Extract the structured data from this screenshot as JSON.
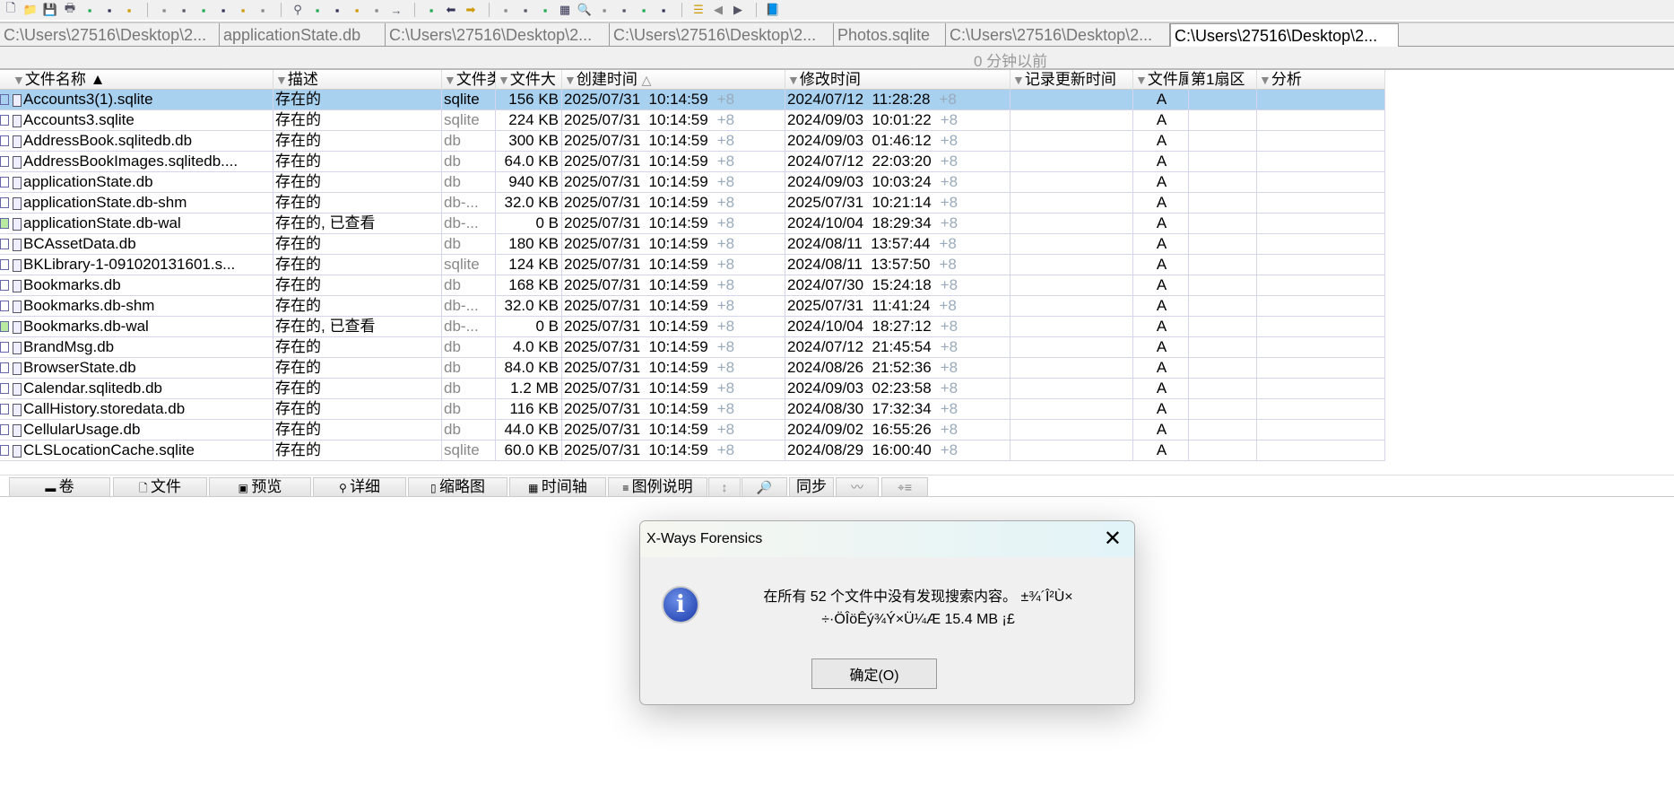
{
  "toolbar": {
    "icons": [
      "new-file-icon",
      "open-folder-icon",
      "save-icon",
      "print-icon",
      "printer-setup-icon",
      "properties-icon",
      "export-icon",
      "undo-icon",
      "copy-icon",
      "cut-icon",
      "paste-icon",
      "paste-special-icon",
      "hex-icon",
      "find-icon",
      "find-hex-icon",
      "find-text-icon",
      "find-next-icon",
      "find-next-hex-icon",
      "goto-icon",
      "goto-offset-icon",
      "back-icon",
      "forward-icon",
      "disk-icon",
      "add-disk-icon",
      "ram-icon",
      "calculator-icon",
      "search-icon",
      "camera-icon",
      "picture-icon",
      "settings-icon",
      "tools-icon",
      "list-icon",
      "left-icon",
      "right-icon",
      "help-icon"
    ]
  },
  "tabs": [
    "C:\\Users\\27516\\Desktop\\2...",
    "applicationState.db",
    "C:\\Users\\27516\\Desktop\\2...",
    "C:\\Users\\27516\\Desktop\\2...",
    "Photos.sqlite",
    "C:\\Users\\27516\\Desktop\\2...",
    "C:\\Users\\27516\\Desktop\\2..."
  ],
  "subtitle": "0 分钟以前",
  "columns": {
    "name": "文件名称",
    "desc": "描述",
    "type": "文件类",
    "size": "文件大",
    "created": "创建时间",
    "modified": "修改时间",
    "record": "记录更新时间",
    "attr": "文件属性",
    "sector": "第1扇区",
    "analysis": "分析"
  },
  "tz": "+8",
  "rows": [
    {
      "name": "Accounts3(1).sqlite",
      "desc": "存在的",
      "type": "sqlite",
      "size": "156 KB",
      "created": "2025/07/31  10:14:59",
      "modified": "2024/07/12  11:28:28",
      "attr": "A"
    },
    {
      "name": "Accounts3.sqlite",
      "desc": "存在的",
      "type": "sqlite",
      "size": "224 KB",
      "created": "2025/07/31  10:14:59",
      "modified": "2024/09/03  10:01:22",
      "attr": "A"
    },
    {
      "name": "AddressBook.sqlitedb.db",
      "desc": "存在的",
      "type": "db",
      "size": "300 KB",
      "created": "2025/07/31  10:14:59",
      "modified": "2024/09/03  01:46:12",
      "attr": "A"
    },
    {
      "name": "AddressBookImages.sqlitedb....",
      "desc": "存在的",
      "type": "db",
      "size": "64.0 KB",
      "created": "2025/07/31  10:14:59",
      "modified": "2024/07/12  22:03:20",
      "attr": "A"
    },
    {
      "name": "applicationState.db",
      "desc": "存在的",
      "type": "db",
      "size": "940 KB",
      "created": "2025/07/31  10:14:59",
      "modified": "2024/09/03  10:03:24",
      "attr": "A"
    },
    {
      "name": "applicationState.db-shm",
      "desc": "存在的",
      "type": "db-...",
      "size": "32.0 KB",
      "created": "2025/07/31  10:14:59",
      "modified": "2025/07/31  10:21:14",
      "attr": "A"
    },
    {
      "name": "applicationState.db-wal",
      "desc": "存在的, 已查看",
      "type": "db-...",
      "size": "0 B",
      "created": "2025/07/31  10:14:59",
      "modified": "2024/10/04  18:29:34",
      "attr": "A",
      "viewed": true
    },
    {
      "name": "BCAssetData.db",
      "desc": "存在的",
      "type": "db",
      "size": "180 KB",
      "created": "2025/07/31  10:14:59",
      "modified": "2024/08/11  13:57:44",
      "attr": "A"
    },
    {
      "name": "BKLibrary-1-091020131601.s...",
      "desc": "存在的",
      "type": "sqlite",
      "size": "124 KB",
      "created": "2025/07/31  10:14:59",
      "modified": "2024/08/11  13:57:50",
      "attr": "A"
    },
    {
      "name": "Bookmarks.db",
      "desc": "存在的",
      "type": "db",
      "size": "168 KB",
      "created": "2025/07/31  10:14:59",
      "modified": "2024/07/30  15:24:18",
      "attr": "A"
    },
    {
      "name": "Bookmarks.db-shm",
      "desc": "存在的",
      "type": "db-...",
      "size": "32.0 KB",
      "created": "2025/07/31  10:14:59",
      "modified": "2025/07/31  11:41:24",
      "attr": "A"
    },
    {
      "name": "Bookmarks.db-wal",
      "desc": "存在的, 已查看",
      "type": "db-...",
      "size": "0 B",
      "created": "2025/07/31  10:14:59",
      "modified": "2024/10/04  18:27:12",
      "attr": "A",
      "viewed": true
    },
    {
      "name": "BrandMsg.db",
      "desc": "存在的",
      "type": "db",
      "size": "4.0 KB",
      "created": "2025/07/31  10:14:59",
      "modified": "2024/07/12  21:45:54",
      "attr": "A"
    },
    {
      "name": "BrowserState.db",
      "desc": "存在的",
      "type": "db",
      "size": "84.0 KB",
      "created": "2025/07/31  10:14:59",
      "modified": "2024/08/26  21:52:36",
      "attr": "A"
    },
    {
      "name": "Calendar.sqlitedb.db",
      "desc": "存在的",
      "type": "db",
      "size": "1.2 MB",
      "created": "2025/07/31  10:14:59",
      "modified": "2024/09/03  02:23:58",
      "attr": "A"
    },
    {
      "name": "CallHistory.storedata.db",
      "desc": "存在的",
      "type": "db",
      "size": "116 KB",
      "created": "2025/07/31  10:14:59",
      "modified": "2024/08/30  17:32:34",
      "attr": "A"
    },
    {
      "name": "CellularUsage.db",
      "desc": "存在的",
      "type": "db",
      "size": "44.0 KB",
      "created": "2025/07/31  10:14:59",
      "modified": "2024/09/02  16:55:26",
      "attr": "A"
    },
    {
      "name": "CLSLocationCache.sqlite",
      "desc": "存在的",
      "type": "sqlite",
      "size": "60.0 KB",
      "created": "2025/07/31  10:14:59",
      "modified": "2024/08/29  16:00:40",
      "attr": "A"
    }
  ],
  "bottom_tabs": [
    "卷",
    "文件",
    "预览",
    "详细",
    "缩略图",
    "时间轴",
    "图例说明",
    "同步"
  ],
  "dialog": {
    "title": "X-Ways Forensics",
    "line1": "在所有 52 个文件中没有发现搜索内容。 ±¾´Î²Ù×",
    "line2": "÷·ÖÎöÊý¾Ý×Ü¼Æ 15.4 MB ¡£",
    "ok": "确定(O)"
  }
}
